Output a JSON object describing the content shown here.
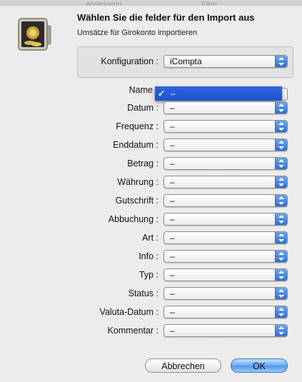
{
  "background_window": {
    "items": [
      "Absteigend",
      "Filter"
    ]
  },
  "dialog": {
    "title": "Wählen Sie die felder für den Import aus",
    "subtitle": "Umsätze für Girokonto importieren"
  },
  "config": {
    "label": "Konfiguration :",
    "value": "iCompta"
  },
  "fields": [
    {
      "label": "Name",
      "value": "–"
    },
    {
      "label": "Datum :",
      "value": "–"
    },
    {
      "label": "Frequenz :",
      "value": "–"
    },
    {
      "label": "Enddatum :",
      "value": "–"
    },
    {
      "label": "Betrag :",
      "value": "–"
    },
    {
      "label": "Währung :",
      "value": "–"
    },
    {
      "label": "Gutschrift :",
      "value": "–"
    },
    {
      "label": "Abbuchung :",
      "value": "–"
    },
    {
      "label": "Art :",
      "value": "–"
    },
    {
      "label": "Info :",
      "value": "–"
    },
    {
      "label": "Typ :",
      "value": "–"
    },
    {
      "label": "Status :",
      "value": "–"
    },
    {
      "label": "Valuta-Datum :",
      "value": "–"
    },
    {
      "label": "Kommentar :",
      "value": "–"
    }
  ],
  "open_menu": {
    "check": "✓",
    "value": "–"
  },
  "buttons": {
    "cancel": "Abbrechen",
    "ok": "OK"
  },
  "colors": {
    "accent": "#2b66e0",
    "default_button": "#6aaaf2"
  },
  "icons": {
    "dialog_icon": "vault-safe-icon",
    "popup_arrows": "up-down-arrows-icon"
  }
}
